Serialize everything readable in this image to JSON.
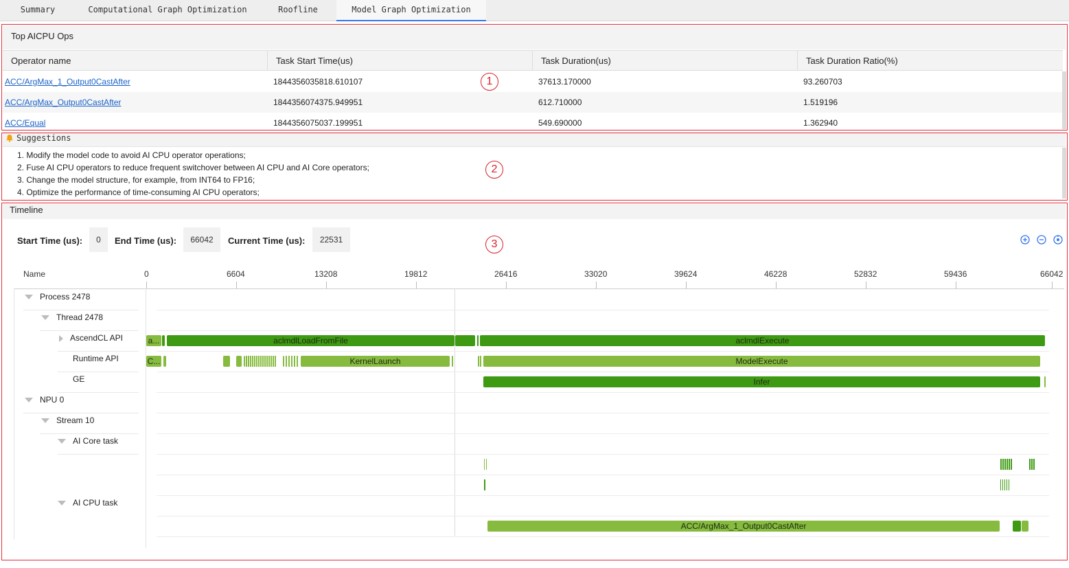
{
  "tabs": [
    {
      "label": "Summary"
    },
    {
      "label": "Computational Graph Optimization"
    },
    {
      "label": "Roofline"
    },
    {
      "label": "Model Graph Optimization"
    }
  ],
  "callouts": [
    "1",
    "2",
    "3"
  ],
  "top_aicpu": {
    "title": "Top AICPU Ops",
    "columns": [
      "Operator name",
      "Task Start Time(us)",
      "Task Duration(us)",
      "Task Duration Ratio(%)"
    ],
    "rows": [
      {
        "name": "ACC/ArgMax_1_Output0CastAfter",
        "start": "1844356035818.610107",
        "duration": "37613.170000",
        "ratio": "93.260703"
      },
      {
        "name": "ACC/ArgMax_Output0CastAfter",
        "start": "1844356074375.949951",
        "duration": "612.710000",
        "ratio": "1.519196"
      },
      {
        "name": "ACC/Equal",
        "start": "1844356075037.199951",
        "duration": "549.690000",
        "ratio": "1.362940"
      }
    ]
  },
  "suggestions": {
    "title": "Suggestions",
    "items": [
      "1. Modify the model code to avoid AI CPU operator operations;",
      "2. Fuse AI CPU operators to reduce frequent switchover between AI CPU and AI Core operators;",
      "3. Change the model structure, for example, from INT64 to FP16;",
      "4. Optimize the performance of time-consuming AI CPU operators;"
    ]
  },
  "timeline": {
    "title": "Timeline",
    "start_label": "Start Time (us):",
    "start_value": "0",
    "end_label": "End Time (us):",
    "end_value": "66042",
    "current_label": "Current Time (us):",
    "current_value": "22531",
    "name_header": "Name",
    "ticks": [
      "0",
      "6604",
      "13208",
      "19812",
      "26416",
      "33020",
      "39624",
      "46228",
      "52832",
      "59436",
      "66042"
    ],
    "tree": {
      "process": "Process 2478",
      "thread": "Thread 2478",
      "ascendcl": "AscendCL API",
      "runtime": "Runtime API",
      "ge": "GE",
      "npu": "NPU 0",
      "stream": "Stream 10",
      "aicore": "AI Core task",
      "aicpu": "AI CPU task"
    },
    "bars": {
      "acl_short": "a...",
      "acl_load": "aclmdlLoadFromFile",
      "acl_exec": "aclmdlExecute",
      "rt_short": "C...",
      "rt_kernel": "KernelLaunch",
      "rt_model": "ModelExecute",
      "ge_infer": "Infer",
      "aicpu_op": "ACC/ArgMax_1_Output0CastAfter"
    },
    "colors": {
      "dark": "#3f9a13",
      "light": "#86bb3f",
      "accent": "#3574f0",
      "callout": "#e0303a"
    }
  }
}
